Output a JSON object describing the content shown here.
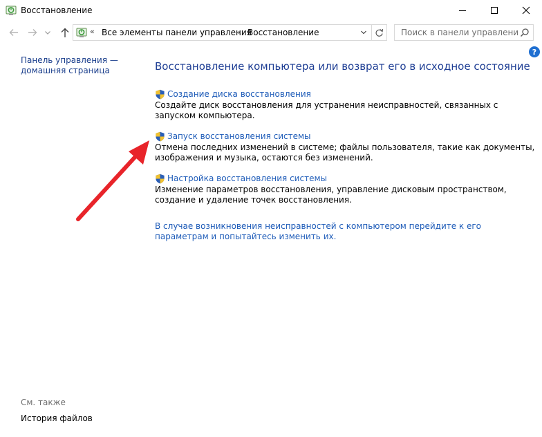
{
  "window": {
    "title": "Восстановление"
  },
  "address_bar": {
    "overflow_chevron": "«",
    "segments": [
      "Все элементы панели управления",
      "Восстановление"
    ],
    "separator": "›"
  },
  "search": {
    "placeholder": "Поиск в панели управления"
  },
  "help": {
    "label": "?"
  },
  "left_pane": {
    "home_link": "Панель управления — домашняя страница",
    "see_also_heading": "См. также",
    "see_also_items": [
      "История файлов"
    ]
  },
  "main": {
    "title": "Восстановление компьютера или возврат его в исходное состояние",
    "tasks": [
      {
        "link": "Создание диска восстановления",
        "description": "Создайте диск восстановления для устранения неисправностей, связанных с запуском компьютера."
      },
      {
        "link": "Запуск восстановления системы",
        "description": "Отмена последних изменений в системе; файлы пользователя, такие как документы, изображения и музыка, остаются без изменений."
      },
      {
        "link": "Настройка восстановления системы",
        "description": "Изменение параметров восстановления, управление дисковым пространством, создание и удаление точек восстановления."
      }
    ],
    "bottom_link": "В случае возникновения неисправностей с компьютером перейдите к его параметрам и попытайтесь изменить их."
  },
  "colors": {
    "link": "#1d5bb8",
    "title": "#1e3e94",
    "annotation_arrow": "#e8242a",
    "shield_blue": "#2a5fb8",
    "shield_yellow": "#f2c230"
  },
  "icons": {
    "app": "recovery-icon",
    "back": "arrow-left-icon",
    "forward": "arrow-right-icon",
    "recent": "chevron-down-icon",
    "up": "arrow-up-icon",
    "refresh": "refresh-icon",
    "search": "search-icon",
    "task": "uac-shield-icon"
  }
}
